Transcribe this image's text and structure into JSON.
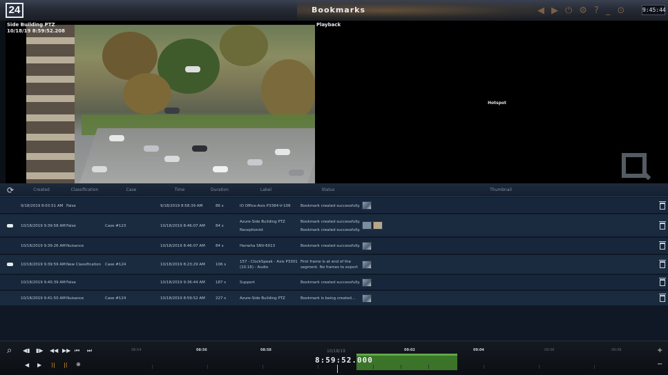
{
  "titlebar": {
    "logo": "24",
    "title": "Bookmarks",
    "clock": "9:45:44",
    "icons": [
      "back-icon",
      "forward-icon",
      "power-icon",
      "gear-icon",
      "help-icon",
      "minimize-icon",
      "fullscreen-icon"
    ]
  },
  "camera": {
    "name": "Side Building PTZ",
    "timestamp": "10/18/19 8:59:52.208"
  },
  "playback": {
    "label": "Playback",
    "hotspot": "Hotspot"
  },
  "table": {
    "columns": [
      "Created",
      "Classification",
      "Case",
      "Time",
      "Duration",
      "Label",
      "Status",
      "Thumbnail"
    ],
    "rows": [
      {
        "created": "9/18/2019 8:03:51 AM",
        "classification": "False",
        "case": "",
        "time": "9/18/2019 8:58:39 AM",
        "duration": "86 s",
        "label": "IO Office-Axis P3384-V-106",
        "status": "Bookmark created successfully.",
        "pinned": false
      },
      {
        "created": "10/18/2019 9:39:58 AM",
        "classification": "False",
        "case": "Case #123",
        "time": "10/18/2019 8:46:07 AM",
        "duration": "84 s",
        "label": "Azure-Side Building PTZ",
        "label2": "Receptionist",
        "status": "Bookmark created successfully.",
        "status2": "Bookmark created successfully.",
        "pinned": true
      },
      {
        "created": "10/18/2019 9:39:26 AM",
        "classification": "Nuisance",
        "case": "",
        "time": "10/18/2019 8:46:07 AM",
        "duration": "84 s",
        "label": "Hanwha SNV-6013",
        "status": "Bookmark created successfully.",
        "pinned": false
      },
      {
        "created": "10/18/2019 9:39:59 AM",
        "classification": "New Classification",
        "case": "Case #124",
        "time": "10/18/2019 8:23:29 AM",
        "duration": "106 s",
        "label": "157 - ClockSpeak - Axis P3301 (10.16) - Audio",
        "status": "First frame is at end of the segment. No frames to export",
        "pinned": true
      },
      {
        "created": "10/18/2019 9:40:39 AM",
        "classification": "False",
        "case": "",
        "time": "10/18/2019 9:36:44 AM",
        "duration": "187 s",
        "label": "Support",
        "status": "Bookmark created successfully.",
        "pinned": false
      },
      {
        "created": "10/18/2019 9:41:50 AM",
        "classification": "Nuisance",
        "case": "Case #124",
        "time": "10/18/2019 8:59:52 AM",
        "duration": "227 s",
        "label": "Azure-Side Building PTZ",
        "status": "Bookmark is being created...",
        "pinned": false
      }
    ]
  },
  "timeline": {
    "ticks": [
      "08:54",
      "08:56",
      "08:58",
      "09:02",
      "09:04",
      "09:06",
      "09:08"
    ],
    "date": "10/18/19",
    "current_time": "8:59:52.000",
    "zoom_in": "+",
    "zoom_out": "−"
  }
}
